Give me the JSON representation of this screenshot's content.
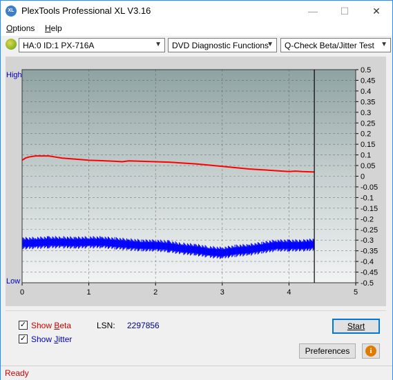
{
  "window": {
    "title": "PlexTools Professional XL V3.16",
    "icon_label": "XL",
    "minimize": "—",
    "maximize": "☐",
    "close": "✕"
  },
  "menu": {
    "options_prefix": "O",
    "options_rest": "ptions",
    "help_prefix": "H",
    "help_rest": "elp"
  },
  "toolbar": {
    "drive": "HA:0 ID:1  PX-716A",
    "function": "DVD Diagnostic Functions",
    "test": "Q-Check Beta/Jitter Test"
  },
  "chart_data": {
    "type": "line",
    "x_ticks": [
      "0",
      "1",
      "2",
      "3",
      "4",
      "5"
    ],
    "xlim": [
      0,
      5
    ],
    "y_ticks": [
      "0.5",
      "0.45",
      "0.4",
      "0.35",
      "0.3",
      "0.25",
      "0.2",
      "0.15",
      "0.1",
      "0.05",
      "0",
      "-0.05",
      "-0.1",
      "-0.15",
      "-0.2",
      "-0.25",
      "-0.3",
      "-0.35",
      "-0.4",
      "-0.45",
      "-0.5"
    ],
    "ylim": [
      -0.5,
      0.5
    ],
    "left_labels": {
      "high": "High",
      "low": "Low"
    },
    "end_marker_x": 4.38,
    "grid": true,
    "series": [
      {
        "name": "Beta",
        "color": "#ff0000",
        "x": [
          0.0,
          0.05,
          0.1,
          0.2,
          0.3,
          0.4,
          0.5,
          0.6,
          0.8,
          1.0,
          1.2,
          1.4,
          1.5,
          1.6,
          1.8,
          2.0,
          2.2,
          2.4,
          2.6,
          2.8,
          3.0,
          3.2,
          3.4,
          3.6,
          3.8,
          4.0,
          4.1,
          4.2,
          4.38
        ],
        "y": [
          0.075,
          0.085,
          0.09,
          0.095,
          0.095,
          0.095,
          0.09,
          0.085,
          0.08,
          0.075,
          0.073,
          0.07,
          0.068,
          0.072,
          0.07,
          0.068,
          0.066,
          0.062,
          0.058,
          0.052,
          0.046,
          0.04,
          0.034,
          0.03,
          0.026,
          0.022,
          0.024,
          0.022,
          0.02
        ]
      },
      {
        "name": "Jitter",
        "color": "#0000ff",
        "x": [
          0.0,
          0.2,
          0.4,
          0.6,
          0.8,
          1.0,
          1.2,
          1.4,
          1.6,
          1.8,
          2.0,
          2.2,
          2.4,
          2.6,
          2.8,
          3.0,
          3.2,
          3.4,
          3.6,
          3.8,
          4.0,
          4.2,
          4.38
        ],
        "y": [
          -0.315,
          -0.313,
          -0.31,
          -0.31,
          -0.312,
          -0.31,
          -0.31,
          -0.315,
          -0.32,
          -0.325,
          -0.325,
          -0.33,
          -0.34,
          -0.345,
          -0.355,
          -0.36,
          -0.35,
          -0.345,
          -0.335,
          -0.325,
          -0.325,
          -0.325,
          -0.32
        ]
      }
    ]
  },
  "controls": {
    "show_beta_prefix": "Show ",
    "show_beta_u": "B",
    "show_beta_rest": "eta",
    "show_beta_color": "#d00000",
    "show_jitter_prefix": "Show ",
    "show_jitter_u": "J",
    "show_jitter_rest": "itter",
    "show_jitter_color": "#0000c0",
    "beta_checked": "✓",
    "jitter_checked": "✓",
    "lsn_label": "LSN:",
    "lsn_value": "2297856",
    "start_label": "Start",
    "preferences_label": "Preferences",
    "info_label": "i"
  },
  "status": {
    "text": "Ready"
  }
}
